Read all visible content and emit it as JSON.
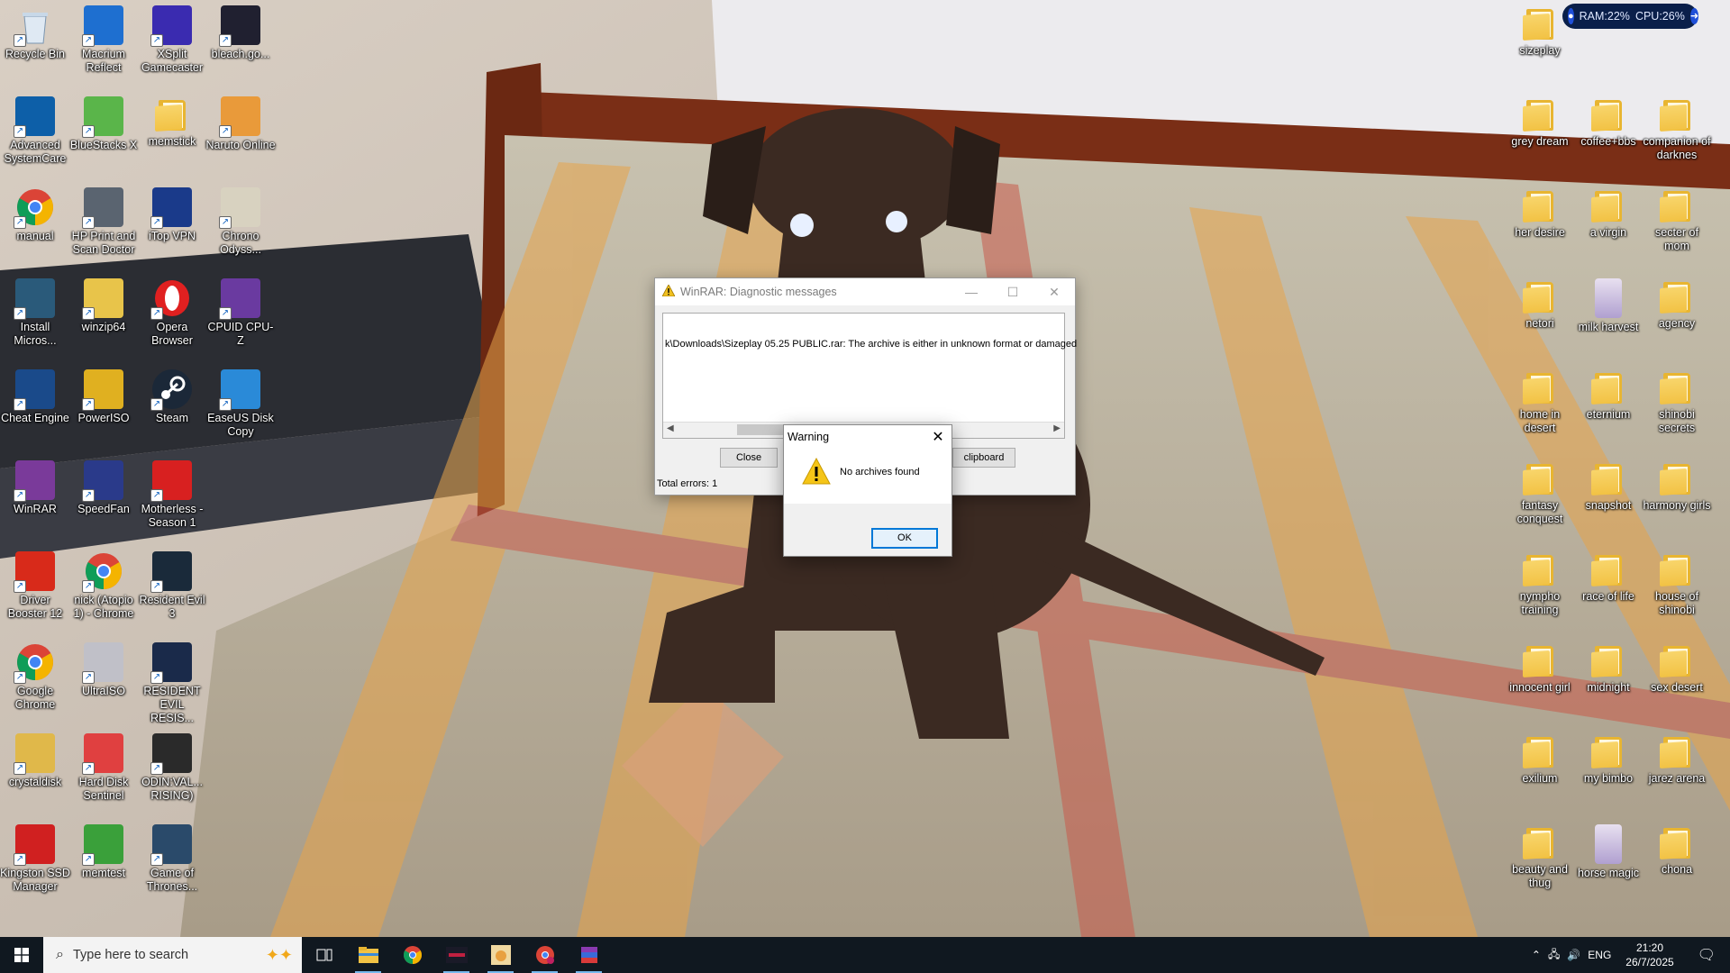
{
  "desktop": {
    "left_icons": [
      {
        "label": "Recycle Bin",
        "icon": "recycle-bin-icon",
        "color": "#9bb7d6"
      },
      {
        "label": "Macrium Reflect",
        "icon": "macrium-icon",
        "color": "#1e6fd0"
      },
      {
        "label": "XSplit Gamecaster",
        "icon": "xsplit-icon",
        "color": "#3a2bb0"
      },
      {
        "label": "bleach.go...",
        "icon": "bleach-icon",
        "color": "#202030"
      },
      {
        "label": "Advanced SystemCare",
        "icon": "systemcare-icon",
        "color": "#0d5fa8"
      },
      {
        "label": "BlueStacks X",
        "icon": "bluestacks-icon",
        "color": "#5ab54a"
      },
      {
        "label": "memstick",
        "icon": "folder-icon",
        "color": "#f2c244"
      },
      {
        "label": "Naruto Online",
        "icon": "naruto-icon",
        "color": "#e99a3a"
      },
      {
        "label": "manual",
        "icon": "chrome-icon",
        "color": "#e0463a"
      },
      {
        "label": "HP Print and Scan Doctor",
        "icon": "hp-icon",
        "color": "#5a6470"
      },
      {
        "label": "iTop VPN",
        "icon": "vpn-icon",
        "color": "#1a3a8a"
      },
      {
        "label": "Chrono Odyss...",
        "icon": "chrono-icon",
        "color": "#d8d2c0"
      },
      {
        "label": "Install Micros...",
        "icon": "install-icon",
        "color": "#2a5a7a"
      },
      {
        "label": "winzip64",
        "icon": "winzip-icon",
        "color": "#e8c44a"
      },
      {
        "label": "Opera Browser",
        "icon": "opera-icon",
        "color": "#e02020"
      },
      {
        "label": "CPUID CPU-Z",
        "icon": "cpuz-icon",
        "color": "#6a3aa0"
      },
      {
        "label": "Cheat Engine",
        "icon": "cheat-engine-icon",
        "color": "#1a4a8a"
      },
      {
        "label": "PowerISO",
        "icon": "poweriso-icon",
        "color": "#e0b020"
      },
      {
        "label": "Steam",
        "icon": "steam-icon",
        "color": "#1b2838"
      },
      {
        "label": "EaseUS Disk Copy",
        "icon": "easeus-icon",
        "color": "#2a8ad8"
      },
      {
        "label": "WinRAR",
        "icon": "winrar-icon",
        "color": "#7a3a9a"
      },
      {
        "label": "SpeedFan",
        "icon": "speedfan-icon",
        "color": "#2a3a8a"
      },
      {
        "label": "Motherless - Season 1",
        "icon": "motherless-icon",
        "color": "#d82020"
      },
      {
        "label": "",
        "icon": "none",
        "color": "transparent"
      },
      {
        "label": "Driver Booster 12",
        "icon": "driver-booster-icon",
        "color": "#d82a1a"
      },
      {
        "label": "nick (Atopio 1) - Chrome",
        "icon": "chrome-icon",
        "color": "#e0463a"
      },
      {
        "label": "Resident Evil 3",
        "icon": "re3-icon",
        "color": "#1a2a3a"
      },
      {
        "label": "",
        "icon": "none",
        "color": "transparent"
      },
      {
        "label": "Google Chrome",
        "icon": "chrome-icon",
        "color": "#e0463a"
      },
      {
        "label": "UltraISO",
        "icon": "ultraiso-icon",
        "color": "#c0c0c8"
      },
      {
        "label": "RESIDENT EVIL RESIS...",
        "icon": "re-resistance-icon",
        "color": "#1a2a4a"
      },
      {
        "label": "",
        "icon": "none",
        "color": "transparent"
      },
      {
        "label": "crystaldisk",
        "icon": "crystaldisk-icon",
        "color": "#e0b84a"
      },
      {
        "label": "Hard Disk Sentinel",
        "icon": "hdsentinel-icon",
        "color": "#e04040"
      },
      {
        "label": "ODIN:VAL... RISING)",
        "icon": "odin-icon",
        "color": "#2a2a2a"
      },
      {
        "label": "",
        "icon": "none",
        "color": "transparent"
      },
      {
        "label": "Kingston SSD Manager",
        "icon": "kingston-icon",
        "color": "#d02020"
      },
      {
        "label": "memtest",
        "icon": "memtest-icon",
        "color": "#3aa03a"
      },
      {
        "label": "Game of Thrones...",
        "icon": "got-icon",
        "color": "#2a4a6a"
      }
    ],
    "right_icons": [
      {
        "label": "sizeplay",
        "type": "folder"
      },
      {
        "label": "",
        "type": "none"
      },
      {
        "label": "",
        "type": "none"
      },
      {
        "label": "grey dream",
        "type": "folder"
      },
      {
        "label": "coffee+bbs",
        "type": "folder"
      },
      {
        "label": "companion of darknes",
        "type": "folder"
      },
      {
        "label": "her desire",
        "type": "folder"
      },
      {
        "label": "a virgin",
        "type": "folder"
      },
      {
        "label": "secter of mom",
        "type": "folder"
      },
      {
        "label": "netori",
        "type": "folder"
      },
      {
        "label": "milk harvest",
        "type": "app"
      },
      {
        "label": "agency",
        "type": "folder"
      },
      {
        "label": "home in desert",
        "type": "folder"
      },
      {
        "label": "eternium",
        "type": "folder"
      },
      {
        "label": "shinobi secrets",
        "type": "folder"
      },
      {
        "label": "fantasy conquest",
        "type": "folder"
      },
      {
        "label": "snapshot",
        "type": "folder"
      },
      {
        "label": "harmony girls",
        "type": "folder"
      },
      {
        "label": "nympho training",
        "type": "folder"
      },
      {
        "label": "race of life",
        "type": "folder"
      },
      {
        "label": "house of shinobi",
        "type": "folder"
      },
      {
        "label": "innocent girl",
        "type": "folder"
      },
      {
        "label": "midnight",
        "type": "folder"
      },
      {
        "label": "sex desert",
        "type": "folder"
      },
      {
        "label": "exilium",
        "type": "folder"
      },
      {
        "label": "my bimbo",
        "type": "folder"
      },
      {
        "label": "jarez arena",
        "type": "folder"
      },
      {
        "label": "beauty and thug",
        "type": "folder"
      },
      {
        "label": "horse magic",
        "type": "app"
      },
      {
        "label": "chona",
        "type": "folder"
      }
    ]
  },
  "sysmon": {
    "ram": "RAM:22%",
    "cpu": "CPU:26%"
  },
  "diagnostic_window": {
    "title": "WinRAR: Diagnostic messages",
    "message": "k\\Downloads\\Sizeplay 05.25 PUBLIC.rar: The archive is either in unknown format or damaged",
    "close_label": "Close",
    "clipboard_label": "clipboard",
    "status": "Total errors: 1",
    "min_glyph": "—",
    "max_glyph": "☐",
    "close_glyph": "✕"
  },
  "warning_dialog": {
    "title": "Warning",
    "message": "No archives found",
    "ok_label": "OK",
    "close_glyph": "✕"
  },
  "taskbar": {
    "search_placeholder": "Type here to search",
    "language": "ENG",
    "time": "21:20",
    "date": "26/7/2025",
    "apps": [
      {
        "icon": "task-view-icon",
        "active": false
      },
      {
        "icon": "file-explorer-icon",
        "active": true
      },
      {
        "icon": "chrome-icon",
        "active": false
      },
      {
        "icon": "bleach-icon",
        "active": true
      },
      {
        "icon": "naruto-icon",
        "active": true
      },
      {
        "icon": "chrome-profile-icon",
        "active": true
      },
      {
        "icon": "winrar-icon",
        "active": true
      }
    ]
  }
}
